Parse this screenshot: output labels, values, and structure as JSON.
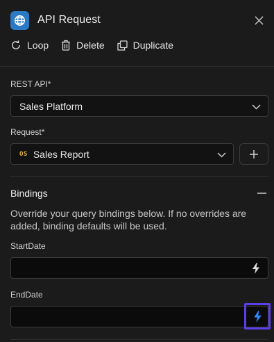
{
  "header": {
    "title": "API Request",
    "app_icon": "globe-icon",
    "close_icon": "close-icon"
  },
  "actions": {
    "loop": {
      "label": "Loop",
      "icon": "loop-icon"
    },
    "delete": {
      "label": "Delete",
      "icon": "trash-icon"
    },
    "duplicate": {
      "label": "Duplicate",
      "icon": "duplicate-icon"
    }
  },
  "form": {
    "rest_api": {
      "label": "REST API*",
      "value": "Sales Platform"
    },
    "request": {
      "label": "Request*",
      "badge": "OS",
      "value": "Sales Report"
    }
  },
  "bindings": {
    "title": "Bindings",
    "description": "Override your query bindings below. If no overrides are added, binding defaults will be used.",
    "fields": [
      {
        "label": "StartDate",
        "value": ""
      },
      {
        "label": "EndDate",
        "value": ""
      }
    ]
  },
  "colors": {
    "background": "#1b1b1b",
    "app_icon_bg": "#2c79c4",
    "badge": "#e2b43a",
    "active_bolt": "#2a8cff",
    "highlight": "#5b3fe8"
  }
}
